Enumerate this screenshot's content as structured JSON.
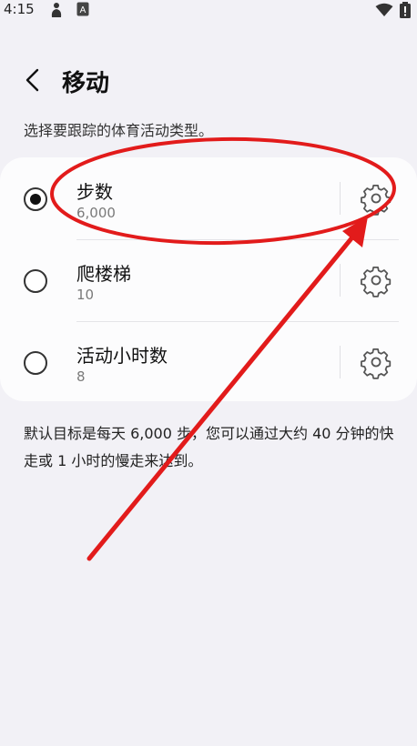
{
  "status_bar": {
    "time": "4:15",
    "icons_left": [
      "game-icon",
      "app-a-icon"
    ],
    "icons_right": [
      "wifi-icon",
      "battery-icon"
    ]
  },
  "header": {
    "back_icon": "chevron-left-icon",
    "title": "移动"
  },
  "description": "选择要跟踪的体育活动类型。",
  "options": [
    {
      "label": "步数",
      "value": "6,000",
      "selected": true
    },
    {
      "label": "爬楼梯",
      "value": "10",
      "selected": false
    },
    {
      "label": "活动小时数",
      "value": "8",
      "selected": false
    }
  ],
  "footer": {
    "note": "默认目标是每天 6,000 步，您可以通过大约 40 分钟的快走或 1 小时的慢走来达到。"
  },
  "colors": {
    "background": "#f2f1f6",
    "card": "#fcfcfd",
    "annotation": "#e21b1b"
  }
}
